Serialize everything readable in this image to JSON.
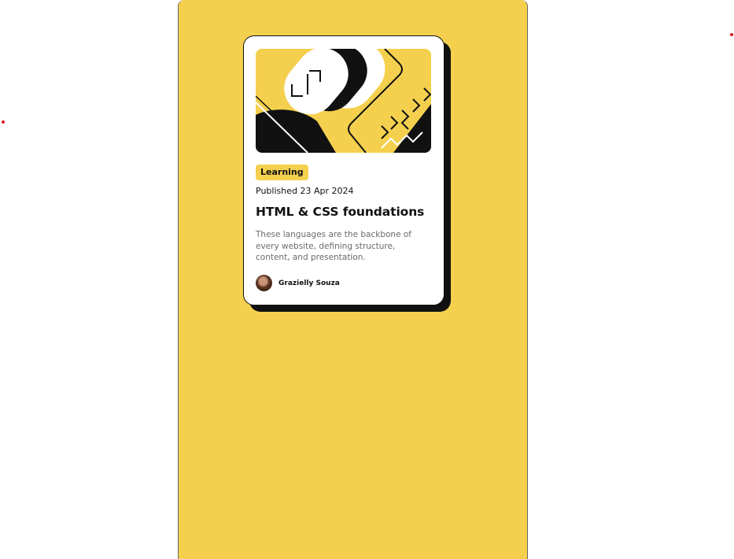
{
  "card": {
    "tag": "Learning",
    "published": "Published 23 Apr 2024",
    "title": "HTML & CSS foundations",
    "description": "These languages are the backbone of every website, defining structure, content, and presentation.",
    "author": "Grazielly Souza"
  },
  "colors": {
    "accent": "#f4d04e",
    "ink": "#111111",
    "card_background": "#ffffff",
    "muted_text": "#6b6b6b",
    "marker_dot": "#e01818"
  },
  "icons": {
    "hero": "abstract-illustration",
    "avatar": "author-avatar"
  }
}
